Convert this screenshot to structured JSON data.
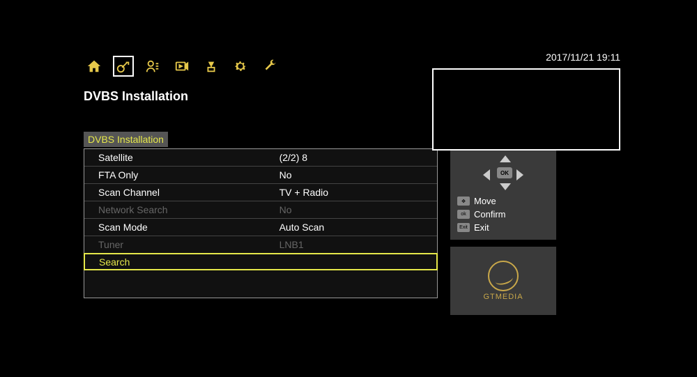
{
  "datetime": "2017/11/21  19:11",
  "page_title": "DVBS Installation",
  "tab_label": "DVBS Installation",
  "menu": [
    {
      "label": "Satellite",
      "value": "(2/2) 8",
      "disabled": false,
      "highlight": false
    },
    {
      "label": "FTA Only",
      "value": "No",
      "disabled": false,
      "highlight": false
    },
    {
      "label": "Scan Channel",
      "value": "TV + Radio",
      "disabled": false,
      "highlight": false
    },
    {
      "label": "Network Search",
      "value": "No",
      "disabled": true,
      "highlight": false
    },
    {
      "label": "Scan Mode",
      "value": "Auto Scan",
      "disabled": false,
      "highlight": false
    },
    {
      "label": "Tuner",
      "value": "LNB1",
      "disabled": true,
      "highlight": false
    },
    {
      "label": "Search",
      "value": "",
      "disabled": false,
      "highlight": true
    }
  ],
  "hints": {
    "ok": "OK",
    "move": "Move",
    "confirm": "Confirm",
    "exit": "Exit",
    "move_key": "✥",
    "confirm_key": "ok",
    "exit_key": "Exit"
  },
  "brand": "GTMEDIA",
  "icons": {
    "home": "home-icon",
    "satellite": "satellite-icon",
    "user": "user-icon",
    "media": "media-icon",
    "network": "network-icon",
    "settings": "gear-icon",
    "tools": "wrench-icon"
  }
}
